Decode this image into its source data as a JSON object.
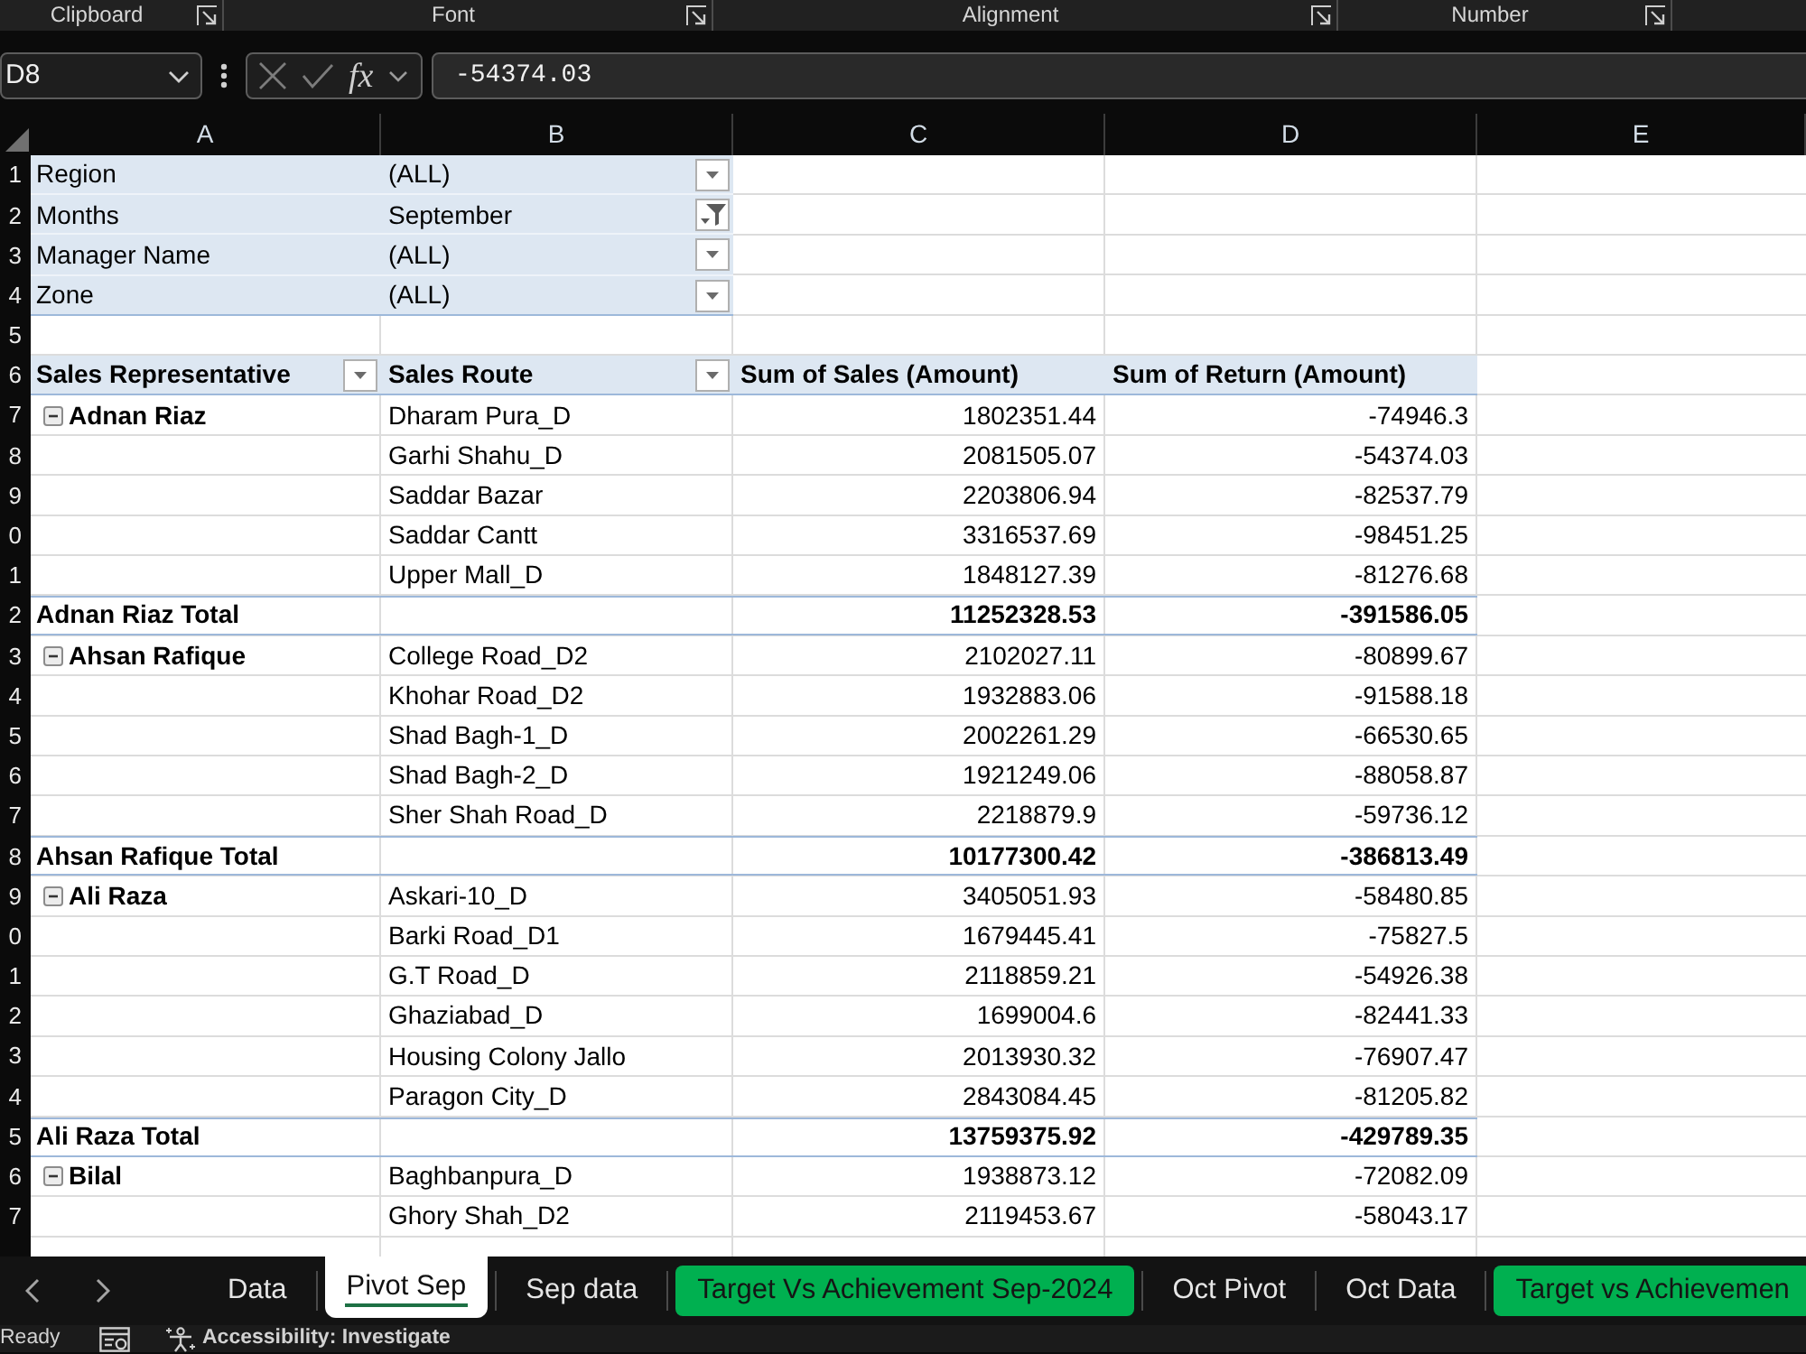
{
  "ribbon": {
    "groups": [
      {
        "label": "Clipboard"
      },
      {
        "label": "Font"
      },
      {
        "label": "Alignment"
      },
      {
        "label": "Number"
      }
    ]
  },
  "formula_bar": {
    "name_box": "D8",
    "function_label": "fx",
    "formula": "-54374.03"
  },
  "column_letters": [
    "A",
    "B",
    "C",
    "D",
    "E"
  ],
  "row_numbers": [
    "1",
    "2",
    "3",
    "4",
    "5",
    "6",
    "7",
    "8",
    "9",
    "0",
    "1",
    "2",
    "3",
    "4",
    "5",
    "6",
    "7",
    "8",
    "9",
    "0",
    "1",
    "2",
    "3",
    "4",
    "5",
    "6",
    "7"
  ],
  "pivot": {
    "filters": [
      {
        "field": "Region",
        "value": "(ALL)",
        "filtered": false
      },
      {
        "field": "Months",
        "value": "September",
        "filtered": true
      },
      {
        "field": "Manager Name",
        "value": "(ALL)",
        "filtered": false
      },
      {
        "field": "Zone",
        "value": "(ALL)",
        "filtered": false
      }
    ],
    "headers": [
      {
        "label": "Sales Representative",
        "dropdown": true
      },
      {
        "label": "Sales Route",
        "dropdown": true
      },
      {
        "label": "Sum of Sales (Amount)",
        "dropdown": false
      },
      {
        "label": "Sum of Return (Amount)",
        "dropdown": false
      }
    ],
    "groups": [
      {
        "name": "Adnan Riaz",
        "expanded": true,
        "routes": [
          {
            "route": "Dharam Pura_D",
            "sales": "1802351.44",
            "returns": "-74946.3"
          },
          {
            "route": "Garhi Shahu_D",
            "sales": "2081505.07",
            "returns": "-54374.03"
          },
          {
            "route": "Saddar Bazar",
            "sales": "2203806.94",
            "returns": "-82537.79"
          },
          {
            "route": "Saddar Cantt",
            "sales": "3316537.69",
            "returns": "-98451.25"
          },
          {
            "route": "Upper Mall_D",
            "sales": "1848127.39",
            "returns": "-81276.68"
          }
        ],
        "total": {
          "label": "Adnan Riaz Total",
          "sales": "11252328.53",
          "returns": "-391586.05"
        }
      },
      {
        "name": "Ahsan Rafique",
        "expanded": true,
        "routes": [
          {
            "route": "College Road_D2",
            "sales": "2102027.11",
            "returns": "-80899.67"
          },
          {
            "route": "Khohar Road_D2",
            "sales": "1932883.06",
            "returns": "-91588.18"
          },
          {
            "route": "Shad Bagh-1_D",
            "sales": "2002261.29",
            "returns": "-66530.65"
          },
          {
            "route": "Shad Bagh-2_D",
            "sales": "1921249.06",
            "returns": "-88058.87"
          },
          {
            "route": "Sher Shah Road_D",
            "sales": "2218879.9",
            "returns": "-59736.12"
          }
        ],
        "total": {
          "label": "Ahsan Rafique Total",
          "sales": "10177300.42",
          "returns": "-386813.49"
        }
      },
      {
        "name": "Ali Raza",
        "expanded": true,
        "routes": [
          {
            "route": "Askari-10_D",
            "sales": "3405051.93",
            "returns": "-58480.85"
          },
          {
            "route": "Barki Road_D1",
            "sales": "1679445.41",
            "returns": "-75827.5"
          },
          {
            "route": "G.T Road_D",
            "sales": "2118859.21",
            "returns": "-54926.38"
          },
          {
            "route": "Ghaziabad_D",
            "sales": "1699004.6",
            "returns": "-82441.33"
          },
          {
            "route": "Housing Colony Jallo",
            "sales": "2013930.32",
            "returns": "-76907.47"
          },
          {
            "route": "Paragon City_D",
            "sales": "2843084.45",
            "returns": "-81205.82"
          }
        ],
        "total": {
          "label": "Ali Raza Total",
          "sales": "13759375.92",
          "returns": "-429789.35"
        }
      },
      {
        "name": "Bilal",
        "expanded": true,
        "routes": [
          {
            "route": "Baghbanpura_D",
            "sales": "1938873.12",
            "returns": "-72082.09"
          },
          {
            "route": "Ghory Shah_D2",
            "sales": "2119453.67",
            "returns": "-58043.17"
          }
        ]
      }
    ]
  },
  "sheet_tabs": [
    {
      "label": "Data",
      "selected": false
    },
    {
      "label": "Pivot Sep",
      "selected": true
    },
    {
      "label": "Sep data",
      "selected": false
    },
    {
      "label": "Target Vs Achievement Sep-2024",
      "selected": false,
      "color": "#00b050"
    },
    {
      "label": "Oct Pivot",
      "selected": false
    },
    {
      "label": "Oct Data",
      "selected": false
    },
    {
      "label": "Target vs Achievemen",
      "selected": false,
      "color": "#00b050"
    }
  ],
  "status_bar": {
    "status": "Ready",
    "accessibility": "Accessibility: Investigate"
  }
}
